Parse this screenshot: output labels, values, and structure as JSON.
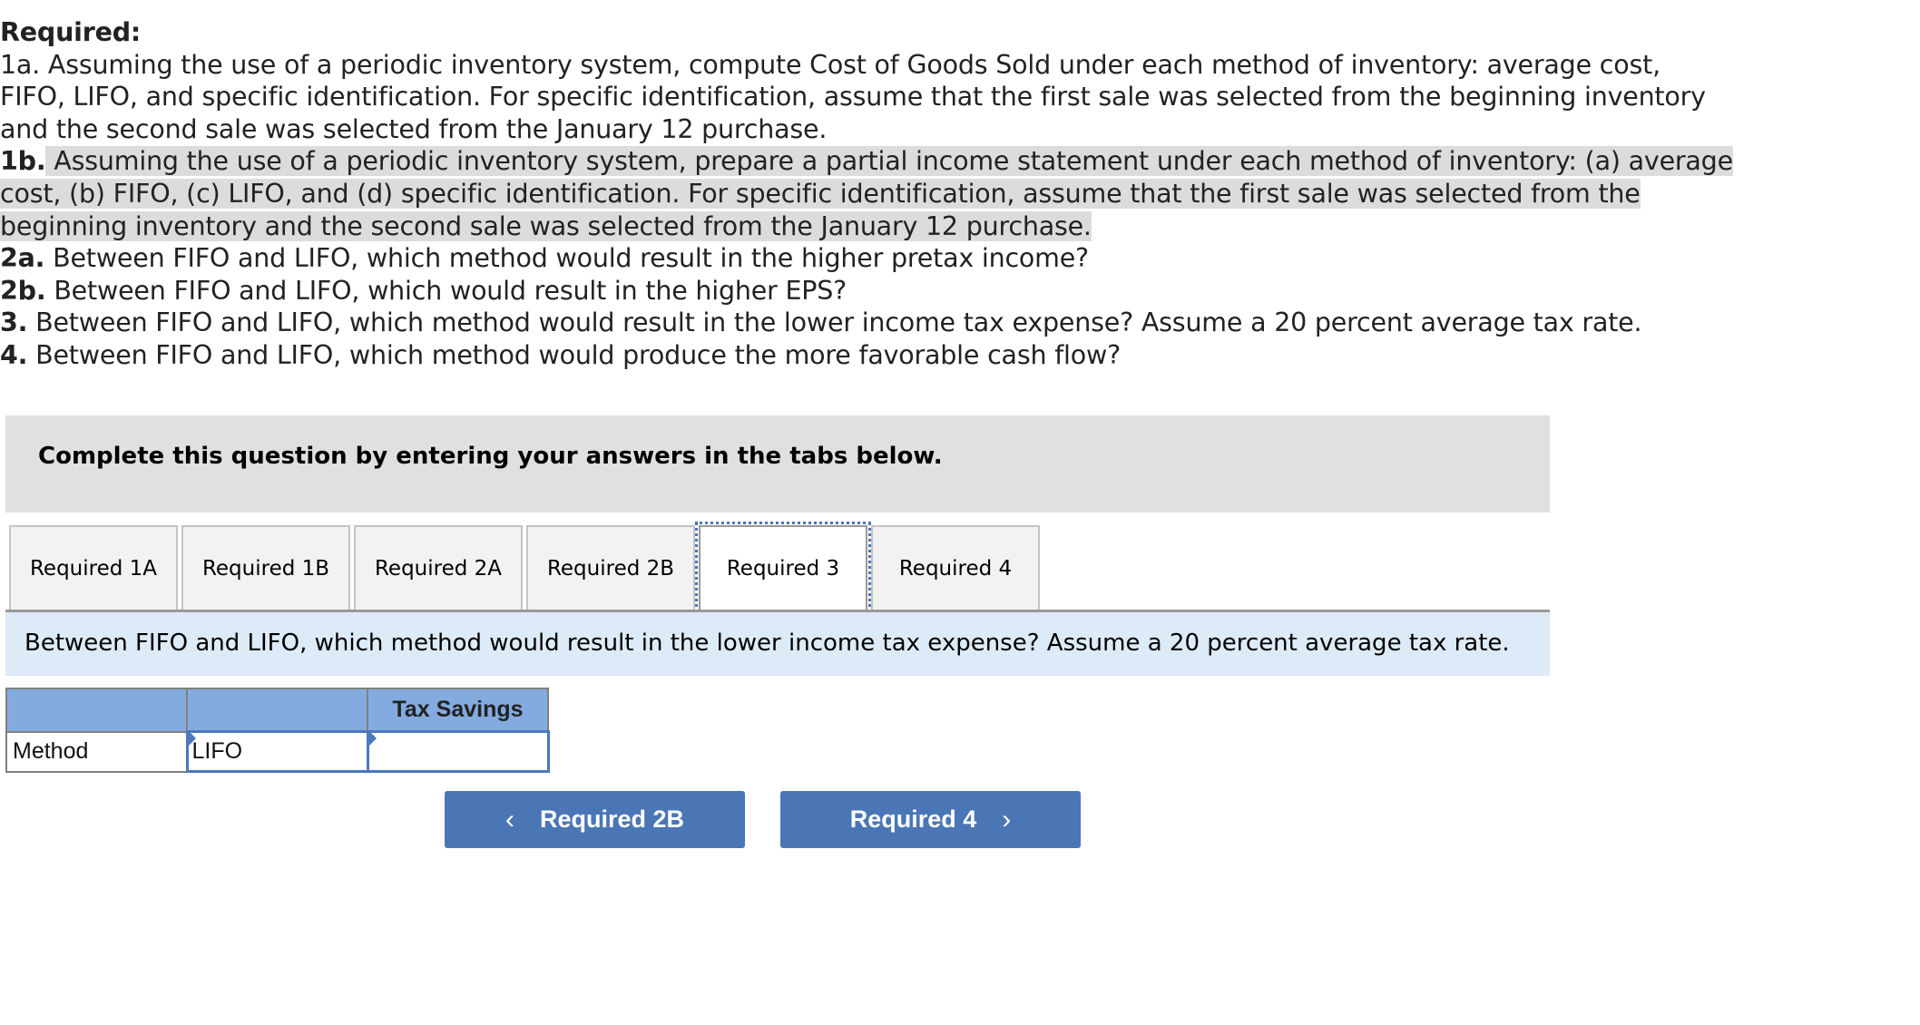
{
  "instructions": {
    "heading": "Required:",
    "items": [
      {
        "label": "1a.",
        "lines": [
          "1a. Assuming the use of a periodic inventory system, compute Cost of Goods Sold under each method of inventory: average cost,",
          "FIFO, LIFO, and specific identification. For specific identification, assume that the first sale was selected from the beginning inventory",
          "and the second sale was selected from the January 12 purchase."
        ]
      },
      {
        "label": "1b.",
        "lines": [
          " Assuming the use of a periodic inventory system, prepare a partial income statement under each method of inventory: (a) average",
          "cost, (b) FIFO, (c) LIFO, and (d) specific identification. For specific identification, assume that the first sale was selected from the",
          "beginning inventory and the second sale was selected from the January 12 purchase."
        ]
      },
      {
        "label": "2a.",
        "text": " Between FIFO and LIFO, which method would result in the higher pretax income?"
      },
      {
        "label": "2b.",
        "text": " Between FIFO and LIFO, which would result in the higher EPS?"
      },
      {
        "label": "3.",
        "text": " Between FIFO and LIFO, which method would result in the lower income tax expense? Assume a 20 percent average tax rate."
      },
      {
        "label": "4.",
        "text": " Between FIFO and LIFO, which method would produce the more favorable cash flow?"
      }
    ]
  },
  "banner": {
    "text": "Complete this question by entering your answers in the tabs below."
  },
  "tabs": [
    {
      "label": "Required 1A",
      "active": false
    },
    {
      "label": "Required 1B",
      "active": false
    },
    {
      "label": "Required 2A",
      "active": false
    },
    {
      "label": "Required 2B",
      "active": false
    },
    {
      "label": "Required 3",
      "active": true
    },
    {
      "label": "Required 4",
      "active": false
    }
  ],
  "question": {
    "text": "Between FIFO and LIFO, which method would result in the lower income tax expense? Assume a 20 percent average tax rate."
  },
  "table": {
    "headers": [
      "",
      "",
      "Tax Savings"
    ],
    "row": {
      "label": "Method",
      "method_value": "LIFO",
      "tax_savings_value": ""
    }
  },
  "nav": {
    "prev_label": "Required 2B",
    "next_label": "Required 4",
    "prev_icon": "chevron-left-icon",
    "next_icon": "chevron-right-icon",
    "prev_glyph": "‹",
    "next_glyph": "›"
  },
  "colors": {
    "highlight": "#dcdcdc",
    "banner_bg": "#e0e0e0",
    "question_bg": "#ddeaf7",
    "table_header_bg": "#84abdf",
    "button_bg": "#4a76b6",
    "focus_outline": "#4a74b4"
  }
}
